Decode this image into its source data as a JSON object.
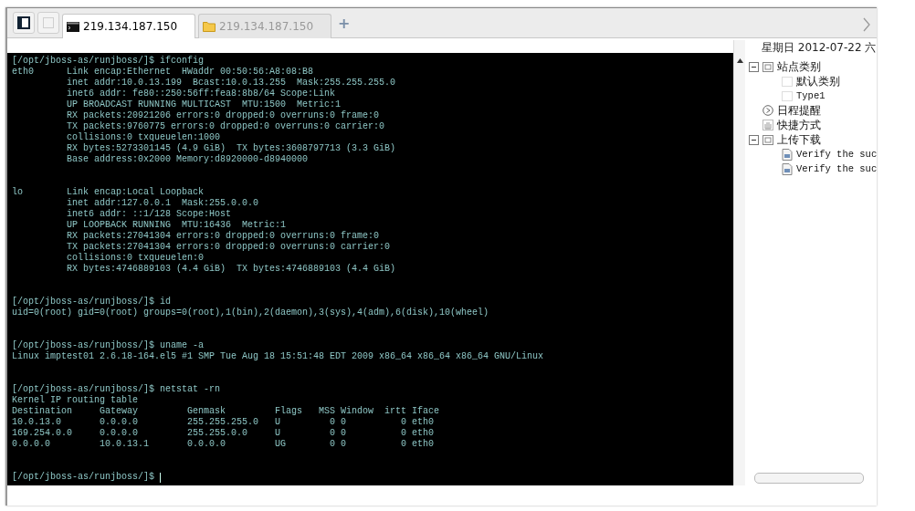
{
  "tabs": [
    {
      "label": "219.134.187.150",
      "kind": "terminal",
      "selected": true
    },
    {
      "label": "219.134.187.150",
      "kind": "folder",
      "selected": false
    }
  ],
  "new_tab": "+",
  "terminal": {
    "blocks": [
      {
        "lines": [
          "[/opt/jboss-as/runjboss/]$ ifconfig",
          "eth0      Link encap:Ethernet  HWaddr 00:50:56:A8:08:B8",
          "          inet addr:10.0.13.199  Bcast:10.0.13.255  Mask:255.255.255.0",
          "          inet6 addr: fe80::250:56ff:fea8:8b8/64 Scope:Link",
          "          UP BROADCAST RUNNING MULTICAST  MTU:1500  Metric:1",
          "          RX packets:20921206 errors:0 dropped:0 overruns:0 frame:0",
          "          TX packets:9760775 errors:0 dropped:0 overruns:0 carrier:0",
          "          collisions:0 txqueuelen:1000",
          "          RX bytes:5273301145 (4.9 GiB)  TX bytes:3608797713 (3.3 GiB)",
          "          Base address:0x2000 Memory:d8920000-d8940000"
        ]
      },
      {
        "lines": [
          "lo        Link encap:Local Loopback",
          "          inet addr:127.0.0.1  Mask:255.0.0.0",
          "          inet6 addr: ::1/128 Scope:Host",
          "          UP LOOPBACK RUNNING  MTU:16436  Metric:1",
          "          RX packets:27041304 errors:0 dropped:0 overruns:0 frame:0",
          "          TX packets:27041304 errors:0 dropped:0 overruns:0 carrier:0",
          "          collisions:0 txqueuelen:0",
          "          RX bytes:4746889103 (4.4 GiB)  TX bytes:4746889103 (4.4 GiB)"
        ]
      },
      {
        "lines": [
          "[/opt/jboss-as/runjboss/]$ id",
          "uid=0(root) gid=0(root) groups=0(root),1(bin),2(daemon),3(sys),4(adm),6(disk),10(wheel)"
        ]
      },
      {
        "lines": [
          "[/opt/jboss-as/runjboss/]$ uname -a",
          "Linux imptest01 2.6.18-164.el5 #1 SMP Tue Aug 18 15:51:48 EDT 2009 x86_64 x86_64 x86_64 GNU/Linux"
        ]
      },
      {
        "lines": [
          "[/opt/jboss-as/runjboss/]$ netstat -rn",
          "Kernel IP routing table",
          "Destination     Gateway         Genmask         Flags   MSS Window  irtt Iface",
          "10.0.13.0       0.0.0.0         255.255.255.0   U         0 0          0 eth0",
          "169.254.0.0     0.0.0.0         255.255.0.0     U         0 0          0 eth0",
          "0.0.0.0         10.0.13.1       0.0.0.0         UG        0 0          0 eth0"
        ]
      }
    ],
    "prompt": "[/opt/jboss-as/runjboss/]$"
  },
  "date": "星期日 2012-07-22 六",
  "tree": [
    {
      "label": "站点类别",
      "kind": "category",
      "expanded": true,
      "children": [
        {
          "label": "默认类别",
          "kind": "subcategory"
        },
        {
          "label": "Type1",
          "kind": "subcategory"
        }
      ]
    },
    {
      "label": "日程提醒",
      "kind": "schedule"
    },
    {
      "label": "快捷方式",
      "kind": "shortcut"
    },
    {
      "label": "上传下载",
      "kind": "category",
      "expanded": true,
      "children": [
        {
          "label": "Verify the suc",
          "kind": "file"
        },
        {
          "label": "Verify the suc",
          "kind": "file"
        }
      ]
    }
  ]
}
